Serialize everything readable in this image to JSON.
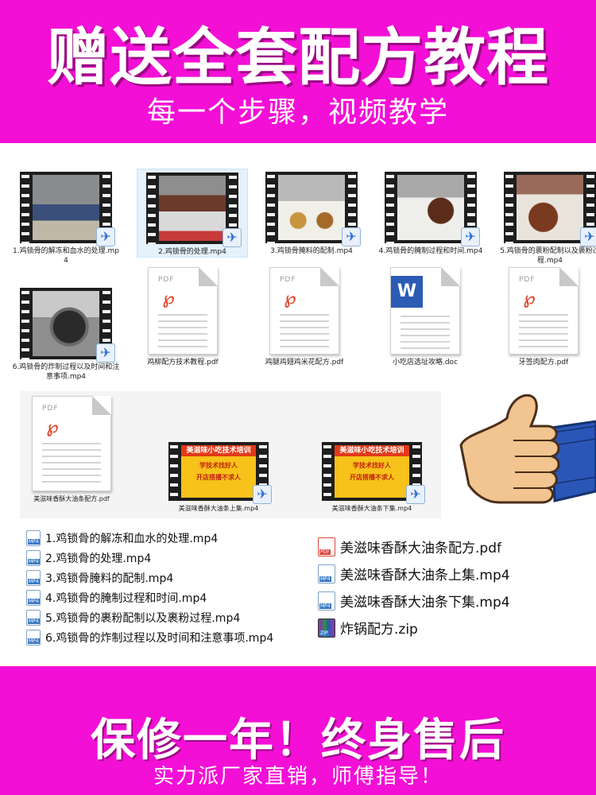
{
  "top_banner": {
    "title": "赠送全套配方教程",
    "subtitle": "每一个步骤，视频教学"
  },
  "grid_row1": [
    {
      "caption": "1.鸡锁骨的解冻和血水的处理.mp4",
      "type": "video",
      "selected": false
    },
    {
      "caption": "2.鸡锁骨的处理.mp4",
      "type": "video",
      "selected": true
    },
    {
      "caption": "3.鸡锁骨腌料的配制.mp4",
      "type": "video",
      "selected": false
    },
    {
      "caption": "4.鸡锁骨的腌制过程和时间.mp4",
      "type": "video",
      "selected": false
    },
    {
      "caption": "5.鸡锁骨的裹粉配制以及裹粉过程.mp4",
      "type": "video",
      "selected": false
    }
  ],
  "grid_row2": [
    {
      "caption": "6.鸡锁骨的炸制过程以及时间和注意事项.mp4",
      "type": "video"
    },
    {
      "caption": "鸡柳配方技术教程.pdf",
      "type": "pdf"
    },
    {
      "caption": "鸡腿鸡翅鸡米花配方.pdf",
      "type": "pdf"
    },
    {
      "caption": "小吃店选址攻略.doc",
      "type": "doc"
    },
    {
      "caption": "牙签肉配方.pdf",
      "type": "pdf"
    }
  ],
  "grid_row3": [
    {
      "caption": "美滋味香酥大油条配方.pdf",
      "type": "pdf"
    },
    {
      "caption": "美滋味香酥大油条上集.mp4",
      "type": "video",
      "poster_title": "美滋味小吃技术培训",
      "poster_line1": "学技术找好人",
      "poster_line2": "开店搭播不求人"
    },
    {
      "caption": "美滋味香酥大油条下集.mp4",
      "type": "video",
      "poster_title": "美滋味小吃技术培训",
      "poster_line1": "学技术找好人",
      "poster_line2": "开店搭播不求人"
    }
  ],
  "icons": {
    "pdf_label": "PDF",
    "pdf_logo": "℘",
    "word_logo": "W",
    "video_badge": "✈",
    "mp4_tag": "MP4",
    "pdf_tag": "PDF",
    "zip_tag": "ZIP"
  },
  "file_list_left": [
    "1.鸡锁骨的解冻和血水的处理.mp4",
    "2.鸡锁骨的处理.mp4",
    "3.鸡锁骨腌料的配制.mp4",
    "4.鸡锁骨的腌制过程和时间.mp4",
    "5.鸡锁骨的裹粉配制以及裹粉过程.mp4",
    "6.鸡锁骨的炸制过程以及时间和注意事项.mp4"
  ],
  "file_list_right": [
    {
      "name": "美滋味香酥大油条配方.pdf",
      "kind": "pdf"
    },
    {
      "name": "美滋味香酥大油条上集.mp4",
      "kind": "mp4"
    },
    {
      "name": "美滋味香酥大油条下集.mp4",
      "kind": "mp4"
    },
    {
      "name": "炸锅配方.zip",
      "kind": "zip"
    }
  ],
  "bottom_banner": {
    "title": "保修一年！终身售后",
    "subtitle": "实力派厂家直销，师傅指导！"
  },
  "colors": {
    "banner": "#f30fd6",
    "pdf_red": "#e0452a",
    "word_blue": "#2b5bb5",
    "selected_bg": "#e5f1fb"
  }
}
